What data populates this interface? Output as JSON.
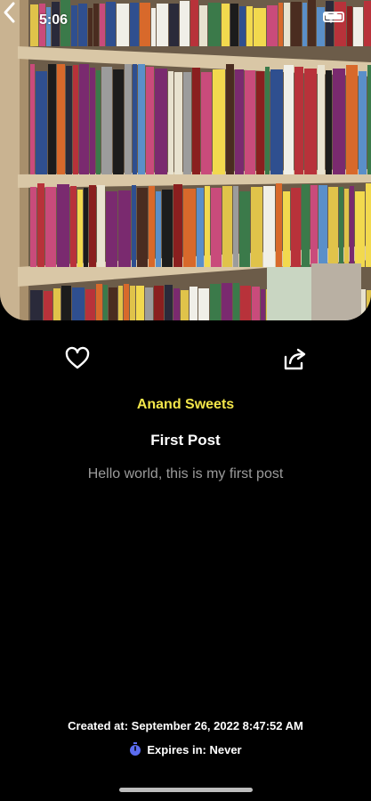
{
  "status_bar": {
    "time": "5:06"
  },
  "post": {
    "author": "Anand Sweets",
    "title": "First Post",
    "body": "Hello world, this is my first post",
    "created_at": "Created at: September 26, 2022 8:47:52 AM",
    "expires": "Expires in: Never"
  },
  "icons": {
    "back": "chevron-left-icon",
    "like": "heart-outline-icon",
    "share": "share-arrow-icon",
    "expires": "timer-icon"
  },
  "colors": {
    "background": "#000000",
    "author": "#f3e64a",
    "title": "#ffffff",
    "body": "#9b9b9b",
    "timer_icon": "#5b6cf0"
  }
}
